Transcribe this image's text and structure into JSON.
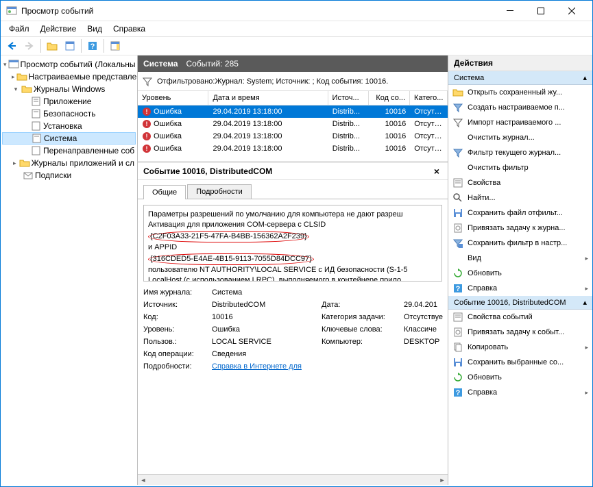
{
  "window": {
    "title": "Просмотр событий"
  },
  "menu": {
    "file": "Файл",
    "action": "Действие",
    "view": "Вид",
    "help": "Справка"
  },
  "tree": {
    "root": "Просмотр событий (Локальны",
    "custom": "Настраиваемые представле",
    "winlogs": "Журналы Windows",
    "app": "Приложение",
    "security": "Безопасность",
    "setup": "Установка",
    "system": "Система",
    "forwarded": "Перенаправленные соб",
    "appservices": "Журналы приложений и сл",
    "subs": "Подписки"
  },
  "header": {
    "title": "Система",
    "count_label": "Событий: 285"
  },
  "filter_text": "Отфильтровано:Журнал: System; Источник: ; Код события: 10016.",
  "columns": {
    "level": "Уровень",
    "datetime": "Дата и время",
    "source": "Источ...",
    "code": "Код со...",
    "category": "Катего..."
  },
  "events": [
    {
      "level": "Ошибка",
      "dt": "29.04.2019 13:18:00",
      "src": "Distrib...",
      "code": "10016",
      "cat": "Отсутс..."
    },
    {
      "level": "Ошибка",
      "dt": "29.04.2019 13:18:00",
      "src": "Distrib...",
      "code": "10016",
      "cat": "Отсутс..."
    },
    {
      "level": "Ошибка",
      "dt": "29.04.2019 13:18:00",
      "src": "Distrib...",
      "code": "10016",
      "cat": "Отсутс..."
    },
    {
      "level": "Ошибка",
      "dt": "29.04.2019 13:18:00",
      "src": "Distrib...",
      "code": "10016",
      "cat": "Отсутс..."
    }
  ],
  "detail": {
    "title": "Событие 10016, DistributedCOM",
    "tab_general": "Общие",
    "tab_details": "Подробности",
    "desc_l1": "Параметры разрешений по умолчанию для компьютера не дают разреш",
    "desc_l2": "Активация для приложения COM-сервера с CLSID",
    "clsid": "{C2F03A33-21F5-47FA-B4BB-156362A2F239}",
    "desc_l3": " и APPID",
    "appid": "{316CDED5-E4AE-4B15-9113-7055D84DCC97}",
    "desc_l4": " пользователю NT AUTHORITY\\LOCAL SERVICE с ИД безопасности (S-1-5",
    "desc_l5": "LocalHost (с использованием LRPC), выполняемого в контейнере прило",
    "kv": {
      "log_k": "Имя журнала:",
      "log_v": "Система",
      "src_k": "Источник:",
      "src_v": "DistributedCOM",
      "date_k": "Дата:",
      "date_v": "29.04.201",
      "code_k": "Код:",
      "code_v": "10016",
      "cat_k": "Категория задачи:",
      "cat_v": "Отсутствуе",
      "lvl_k": "Уровень:",
      "lvl_v": "Ошибка",
      "kw_k": "Ключевые слова:",
      "kw_v": "Классиче",
      "user_k": "Пользов.:",
      "user_v": "LOCAL SERVICE",
      "comp_k": "Компьютер:",
      "comp_v": "DESKTOP",
      "op_k": "Код операции:",
      "op_v": "Сведения",
      "more_k": "Подробности:",
      "more_v": "Справка в Интернете для"
    }
  },
  "actions": {
    "header": "Действия",
    "section1": "Система",
    "section2": "Событие 10016, DistributedCOM",
    "items1": [
      "Открыть сохраненный жу...",
      "Создать настраиваемое п...",
      "Импорт настраиваемого ...",
      "Очистить журнал...",
      "Фильтр текущего журнал...",
      "Очистить фильтр",
      "Свойства",
      "Найти...",
      "Сохранить файл отфильт...",
      "Привязать задачу к журна...",
      "Сохранить фильтр в настр...",
      "Вид",
      "Обновить",
      "Справка"
    ],
    "items2": [
      "Свойства событий",
      "Привязать задачу к событ...",
      "Копировать",
      "Сохранить выбранные со...",
      "Обновить",
      "Справка"
    ]
  }
}
